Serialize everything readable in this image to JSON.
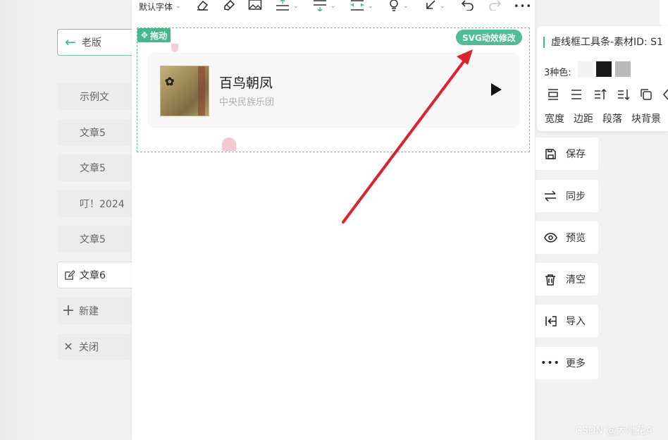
{
  "sidebar": {
    "old_version_label": "老版",
    "items": [
      {
        "label": "示例文"
      },
      {
        "label": "文章5"
      },
      {
        "label": "文章5"
      },
      {
        "label": "叮！2024"
      },
      {
        "label": "文章5"
      },
      {
        "label": "文章6"
      },
      {
        "label": "新建"
      },
      {
        "label": "关闭"
      }
    ]
  },
  "toolbar": {
    "font_select": "默认字体",
    "more": "•••"
  },
  "editor": {
    "drag_label": "拖动",
    "svg_tag": "SVG动效修改",
    "music": {
      "title": "百鸟朝凤",
      "artist": "中央民族乐团"
    }
  },
  "material_panel": {
    "title": "虚线框工具条-素材ID: S1",
    "colors_label": "3种色:",
    "colors": [
      "#f3f3f3",
      "#1a1a1a",
      "#b9b9b9"
    ],
    "labels": [
      "宽度",
      "边距",
      "段落",
      "块背景"
    ]
  },
  "actions": [
    {
      "label": "保存",
      "icon": "save-icon"
    },
    {
      "label": "同步",
      "icon": "sync-icon"
    },
    {
      "label": "预览",
      "icon": "eye-icon"
    },
    {
      "label": "清空",
      "icon": "trash-icon"
    },
    {
      "label": "导入",
      "icon": "import-icon"
    },
    {
      "label": "更多",
      "icon": "more-icon"
    }
  ],
  "watermark": "CSDN @大呲花A",
  "colors": {
    "accent": "#46b88c",
    "dashed_border": "#5fc7a7",
    "arrow": "#e02020"
  }
}
